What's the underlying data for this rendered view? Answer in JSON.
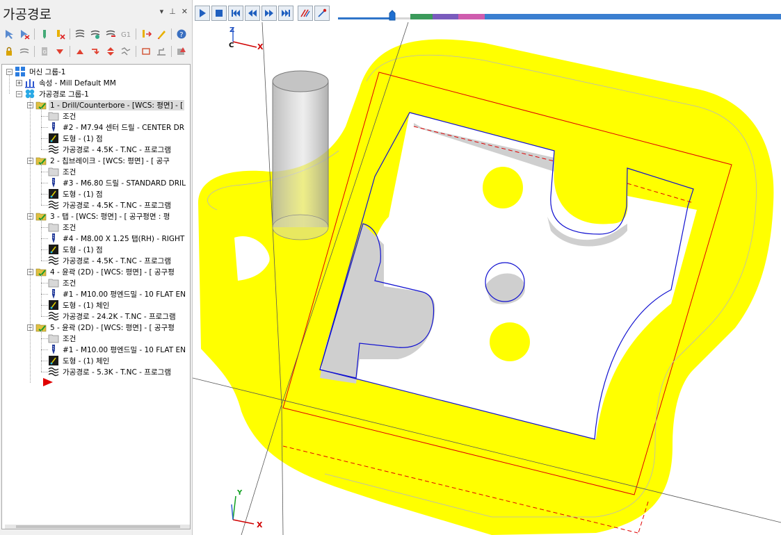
{
  "panel": {
    "title": "가공경로",
    "pin_label": "▾  ⊥  ✕"
  },
  "toolbar_rows": [
    [
      "select-icon",
      "deselect-icon",
      "tool-select-icon",
      "tool-deselect-icon",
      "toolpath-icon",
      "regen-icon",
      "dirty-regen-icon",
      "g1-icon",
      "move-icon",
      "edit-icon",
      "help-icon"
    ],
    [
      "lock-icon",
      "toolpath-toggle-icon",
      "post-icon",
      "move-down-icon",
      "move-up-icon",
      "insert-arrow-icon",
      "expand-icon",
      "filter-icon",
      "crop-icon",
      "level-icon",
      "verify-icon"
    ]
  ],
  "tree": {
    "items": [
      {
        "label": "머신 그룹-1"
      },
      {
        "label": "속성 - Mill Default MM"
      },
      {
        "label": "가공경로 그룹-1"
      },
      {
        "label": "1 - Drill/Counterbore - [WCS: 평면] - ["
      },
      {
        "label": "조건"
      },
      {
        "label": "#2 - M7.94 센터 드릴 - CENTER DR"
      },
      {
        "label": "도형 - (1) 점"
      },
      {
        "label": "가공경로 - 4.5K - T.NC - 프로그램"
      },
      {
        "label": "2 - 칩브레이크 - [WCS: 평면] - [  공구"
      },
      {
        "label": "조건"
      },
      {
        "label": "#3 - M6.80 드릴 - STANDARD DRIL"
      },
      {
        "label": "도형 - (1) 점"
      },
      {
        "label": "가공경로 - 4.5K - T.NC - 프로그램"
      },
      {
        "label": "3 - 탭 - [WCS: 평면] - [  공구평면 : 평"
      },
      {
        "label": "조건"
      },
      {
        "label": "#4 - M8.00 X 1.25 탭(RH) -  RIGHT"
      },
      {
        "label": "도형 - (1) 점"
      },
      {
        "label": "가공경로 - 4.5K - T.NC - 프로그램"
      },
      {
        "label": "4 - 윤곽 (2D) - [WCS: 평면] - [  공구평"
      },
      {
        "label": "조건"
      },
      {
        "label": "#1 - M10.00 평엔드밀 - 10 FLAT EN"
      },
      {
        "label": "도형 - (1) 체인"
      },
      {
        "label": "가공경로 - 24.2K - T.NC - 프로그램"
      },
      {
        "label": "5 - 윤곽 (2D) - [WCS: 평면] - [  공구평"
      },
      {
        "label": "조건"
      },
      {
        "label": "#1 - M10.00 평엔드밀 - 10 FLAT EN"
      },
      {
        "label": "도형 - (1) 체인"
      },
      {
        "label": "가공경로 - 5.3K - T.NC - 프로그램"
      }
    ]
  },
  "playback": {
    "buttons": [
      "play-icon",
      "stop-icon",
      "first-icon",
      "step-back-icon",
      "step-forward-icon",
      "last-icon",
      "toolpath-display-icon",
      "tool-display-icon"
    ],
    "slider_value": 0.75,
    "timeline_segments": [
      {
        "color": "#3b9a5a",
        "fraction": 0.06
      },
      {
        "color": "#7a5bbd",
        "fraction": 0.07
      },
      {
        "color": "#cf5cae",
        "fraction": 0.07
      },
      {
        "color": "#3b7fd0",
        "fraction": 0.8
      }
    ]
  },
  "viewport": {
    "axis_top": {
      "z": "Z",
      "c": "C",
      "x": "X"
    },
    "axis_bottom": {
      "y": "Y",
      "x": "X"
    },
    "colors": {
      "stock": "#ffff00",
      "part_outline": "#1a1aff",
      "boundary": "#e00000",
      "shadow": "#cfcfcf",
      "tool": "#a8a8a8"
    }
  }
}
